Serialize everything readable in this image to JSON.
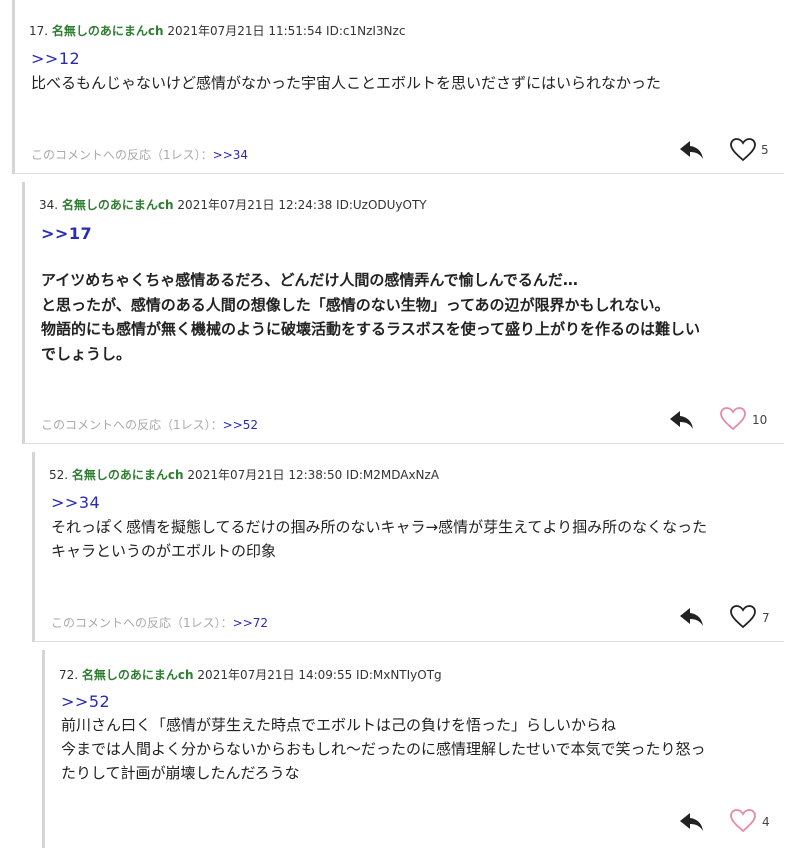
{
  "colors": {
    "name": "#2f7d32",
    "anchor": "#2a2ab8",
    "heart_pink": "#e889a8",
    "heart_dark": "#222222"
  },
  "comments": [
    {
      "number": "17.",
      "name": "名無しのあにまんch",
      "datetime": "2021年07月21日 11:51:54",
      "id": "ID:c1NzI3Nzc",
      "anchor": ">>12",
      "lines": [
        "比べるもんじゃないけど感情がなかった宇宙人ことエボルトを思いださずにはいられなかった"
      ],
      "reaction_text": "このコメントへの反応（1レス）：",
      "reaction_link": ">>34",
      "likes": "5",
      "heart_icon": "heart-outline-dark-icon"
    },
    {
      "number": "34.",
      "name": "名無しのあにまんch",
      "datetime": "2021年07月21日 12:24:38",
      "id": "ID:UzODUyOTY",
      "anchor": ">>17",
      "lines": [
        "アイツめちゃくちゃ感情あるだろ、どんだけ人間の感情弄んで愉しんでるんだ…",
        "と思ったが、感情のある人間の想像した「感情のない生物」ってあの辺が限界かもしれない。",
        "物語的にも感情が無く機械のように破壊活動をするラスボスを使って盛り上がりを作るのは難しい",
        "でしょうし。"
      ],
      "reaction_text": "このコメントへの反応（1レス）：",
      "reaction_link": ">>52",
      "likes": "10",
      "heart_icon": "heart-outline-pink-icon"
    },
    {
      "number": "52.",
      "name": "名無しのあにまんch",
      "datetime": "2021年07月21日 12:38:50",
      "id": "ID:M2MDAxNzA",
      "anchor": ">>34",
      "lines": [
        "それっぽく感情を擬態してるだけの掴み所のないキャラ→感情が芽生えてより掴み所のなくなった",
        "キャラというのがエボルトの印象"
      ],
      "reaction_text": "このコメントへの反応（1レス）：",
      "reaction_link": ">>72",
      "likes": "7",
      "heart_icon": "heart-outline-dark-icon"
    },
    {
      "number": "72.",
      "name": "名無しのあにまんch",
      "datetime": "2021年07月21日 14:09:55",
      "id": "ID:MxNTIyOTg",
      "anchor": ">>52",
      "lines": [
        "前川さん曰く「感情が芽生えた時点でエボルトは己の負けを悟った」らしいからね",
        "今までは人間よく分からないからおもしれ～だったのに感情理解したせいで本気で笑ったり怒っ",
        "たりして計画が崩壊したんだろうな"
      ],
      "likes": "4",
      "heart_icon": "heart-outline-pink-icon"
    }
  ]
}
